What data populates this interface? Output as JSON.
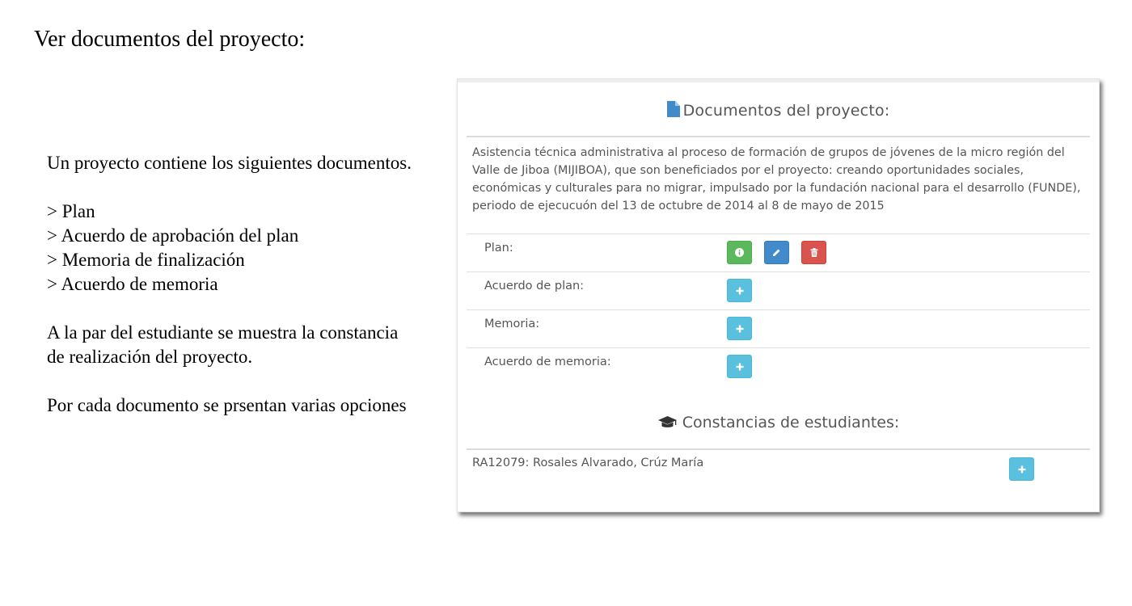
{
  "heading": "Ver documentos del proyecto:",
  "description": {
    "intro": "Un proyecto contiene los siguientes documentos.",
    "items": [
      "> Plan",
      "> Acuerdo de aprobación del plan",
      "> Memoria de finalización",
      "> Acuerdo de memoria"
    ],
    "note_line1": "A la par del estudiante se muestra la constancia",
    "note_line2": "de realización del proyecto.",
    "options": "Por cada documento se prsentan varias opciones"
  },
  "panel": {
    "title": "Documentos del proyecto:",
    "title_icon": "file-icon",
    "project_description": "Asistencia técnica administrativa al proceso de formación de grupos de jóvenes de la micro región del Valle de Jiboa (MIJIBOA), que son beneficiados por el proyecto: creando oportunidades sociales, económicas y culturales para no migrar, impulsado por la fundación nacional para el desarrollo (FUNDE), periodo de ejecucuón del 13 de octubre de 2014 al 8 de mayo de 2015",
    "documents": [
      {
        "label": "Plan:",
        "actions": [
          "info-icon",
          "pencil-icon",
          "trash-icon"
        ]
      },
      {
        "label": "Acuerdo de plan:",
        "actions": [
          "plus-icon"
        ]
      },
      {
        "label": "Memoria:",
        "actions": [
          "plus-icon"
        ]
      },
      {
        "label": "Acuerdo de memoria:",
        "actions": [
          "plus-icon"
        ]
      }
    ],
    "students_title": "Constancias de estudiantes:",
    "students_icon": "graduation-cap-icon",
    "students": [
      {
        "name": "RA12079: Rosales Alvarado, Crúz María",
        "action": "plus-icon"
      }
    ]
  },
  "colors": {
    "success": "#5cb85c",
    "primary": "#428bca",
    "danger": "#d9534f",
    "info": "#5bc0de",
    "file_icon": "#428bca"
  }
}
